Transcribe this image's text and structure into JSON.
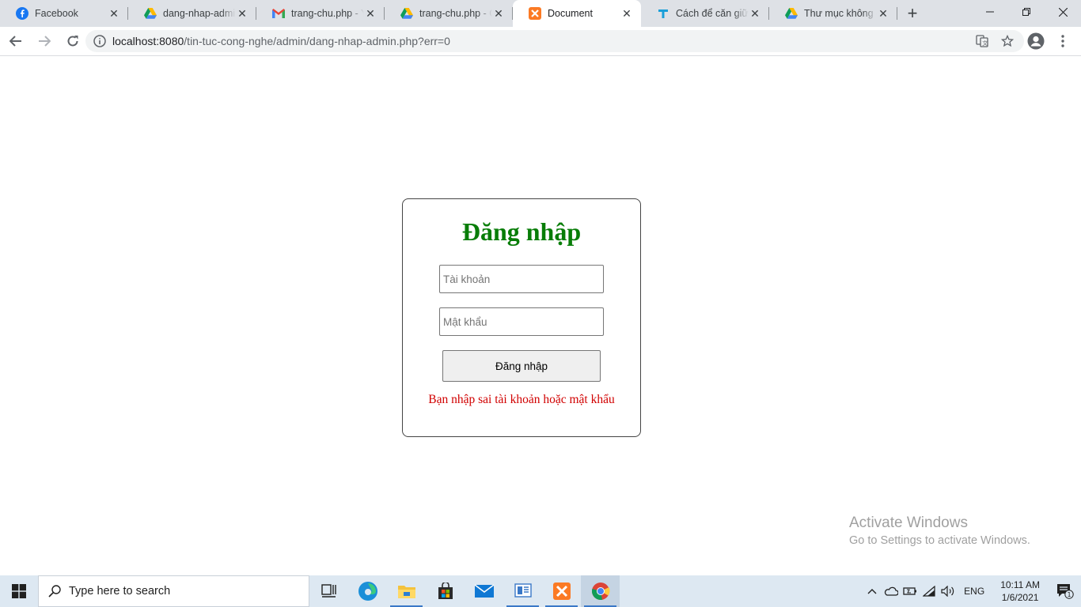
{
  "browser": {
    "tabs": [
      {
        "title": "Facebook",
        "icon": "facebook-icon"
      },
      {
        "title": "dang-nhap-admin",
        "icon": "google-drive-icon"
      },
      {
        "title": "trang-chu.php - Yê",
        "icon": "gmail-icon"
      },
      {
        "title": "trang-chu.php - Gi",
        "icon": "google-drive-icon"
      },
      {
        "title": "Document",
        "icon": "xampp-icon",
        "active": true
      },
      {
        "title": "Cách để căn giữa m",
        "icon": "t-icon"
      },
      {
        "title": "Thư mục không cô",
        "icon": "google-drive-icon"
      }
    ],
    "url_host": "localhost:8080",
    "url_path": "/tin-tuc-cong-nghe/admin/dang-nhap-admin.php?err=0"
  },
  "login": {
    "title": "Đăng nhập",
    "username_placeholder": "Tài khoản",
    "password_placeholder": "Mật khẩu",
    "submit_label": "Đăng nhập",
    "error_message": "Bạn nhập sai tài khoản hoặc mật khẩu"
  },
  "watermark": {
    "line1": "Activate Windows",
    "line2": "Go to Settings to activate Windows."
  },
  "taskbar": {
    "search_placeholder": "Type here to search",
    "language": "ENG",
    "time": "10:11 AM",
    "date": "1/6/2021",
    "notification_count": "1"
  },
  "colors": {
    "title_green": "#087d08",
    "error_red": "#d10000"
  }
}
